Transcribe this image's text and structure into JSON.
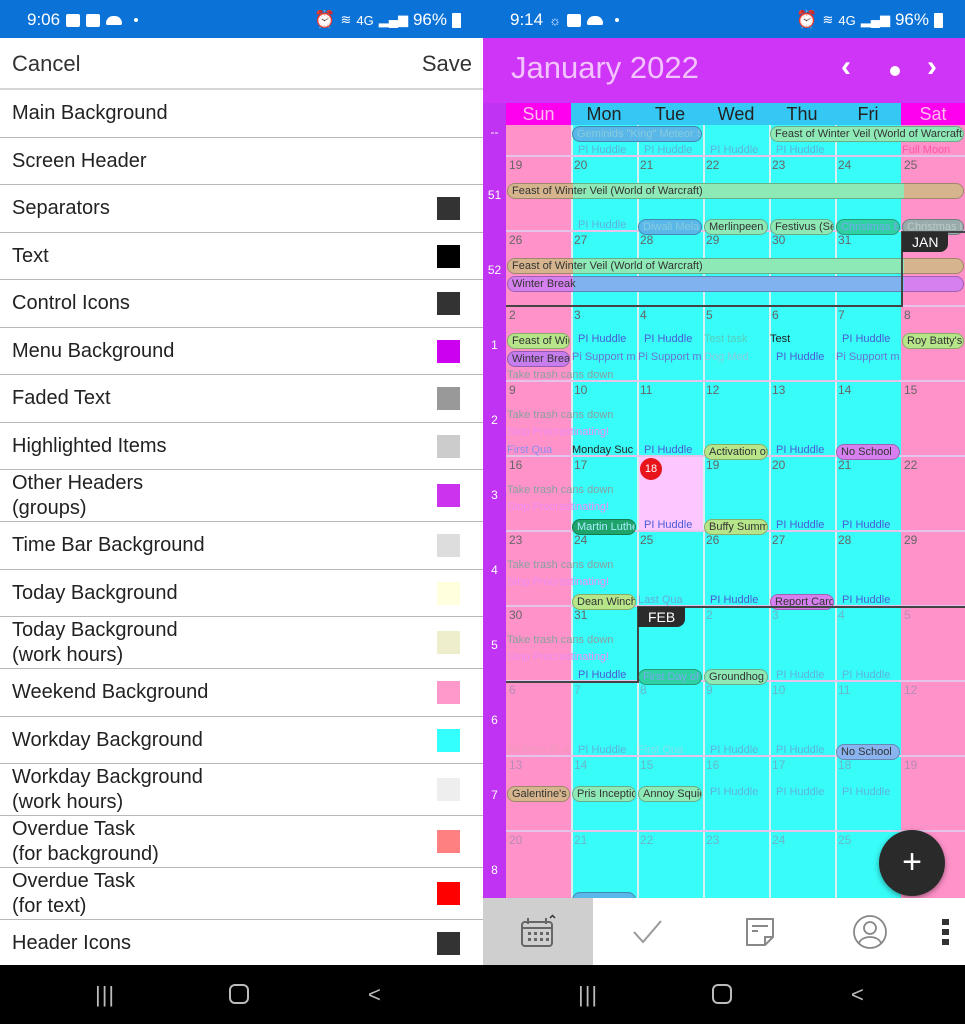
{
  "left": {
    "status_bar": {
      "time": "9:06",
      "battery": "96%",
      "network": "4G"
    },
    "header": {
      "cancel_label": "Cancel",
      "save_label": "Save"
    },
    "settings": [
      {
        "line1": "Main Background",
        "line2": "",
        "color": ""
      },
      {
        "line1": "Screen Header",
        "line2": "",
        "color": ""
      },
      {
        "line1": "Separators",
        "line2": "",
        "color": "#333333"
      },
      {
        "line1": "Text",
        "line2": "",
        "color": "#000000"
      },
      {
        "line1": "Control Icons",
        "line2": "",
        "color": "#333333"
      },
      {
        "line1": "Menu Background",
        "line2": "",
        "color": "#cc00ee"
      },
      {
        "line1": "Faded Text",
        "line2": "",
        "color": "#999999"
      },
      {
        "line1": "Highlighted Items",
        "line2": "",
        "color": "#cccccc"
      },
      {
        "line1": "Other Headers",
        "line2": "(groups)",
        "color": "#cc33ee"
      },
      {
        "line1": "Time Bar Background",
        "line2": "",
        "color": "#dddddd"
      },
      {
        "line1": "Today Background",
        "line2": "",
        "color": "#ffffdd"
      },
      {
        "line1": "Today Background",
        "line2": "(work hours)",
        "color": "#eeeecc"
      },
      {
        "line1": "Weekend Background",
        "line2": "",
        "color": "#ff99cc"
      },
      {
        "line1": "Workday Background",
        "line2": "",
        "color": "#33ffff"
      },
      {
        "line1": "Workday Background",
        "line2": "(work hours)",
        "color": "#eeeeee"
      },
      {
        "line1": "Overdue Task",
        "line2": "(for background)",
        "color": "#ff8080"
      },
      {
        "line1": "Overdue Task",
        "line2": "(for text)",
        "color": "#ff0000"
      },
      {
        "line1": "Header Icons",
        "line2": "",
        "color": "#333333"
      }
    ],
    "nav": {
      "recent": "recent-apps",
      "home": "home",
      "back": "back"
    }
  },
  "right": {
    "status_bar": {
      "time": "9:14",
      "battery": "96%",
      "network": "4G"
    },
    "header": {
      "title": "January 2022",
      "prev_icon": "‹",
      "next_icon": "›"
    },
    "day_headers": [
      "Sun",
      "Mon",
      "Tue",
      "Wed",
      "Thu",
      "Fri",
      "Sat"
    ],
    "weeks": [
      {
        "num": "--",
        "days": [
          "",
          "",
          "",
          "",
          "",
          "",
          ""
        ]
      },
      {
        "num": "51",
        "days": [
          "19",
          "20",
          "21",
          "22",
          "23",
          "24",
          "25"
        ]
      },
      {
        "num": "52",
        "days": [
          "26",
          "27",
          "28",
          "29",
          "30",
          "31",
          ""
        ]
      },
      {
        "num": "1",
        "days": [
          "2",
          "3",
          "4",
          "5",
          "6",
          "7",
          "8"
        ]
      },
      {
        "num": "2",
        "days": [
          "9",
          "10",
          "11",
          "12",
          "13",
          "14",
          "15"
        ]
      },
      {
        "num": "3",
        "days": [
          "16",
          "17",
          "18",
          "19",
          "20",
          "21",
          "22"
        ]
      },
      {
        "num": "4",
        "days": [
          "23",
          "24",
          "25",
          "26",
          "27",
          "28",
          "29"
        ]
      },
      {
        "num": "5",
        "days": [
          "30",
          "31",
          "",
          "2",
          "3",
          "4",
          "5"
        ]
      },
      {
        "num": "6",
        "days": [
          "6",
          "7",
          "8",
          "9",
          "10",
          "11",
          "12"
        ]
      },
      {
        "num": "7",
        "days": [
          "13",
          "14",
          "15",
          "16",
          "17",
          "18",
          "19"
        ]
      },
      {
        "num": "8",
        "days": [
          "20",
          "21",
          "22",
          "23",
          "24",
          "25",
          ""
        ]
      }
    ],
    "today": "18",
    "month_markers": {
      "jan": "JAN",
      "feb": "FEB"
    },
    "events": {
      "geminids": "Geminids \"King\" Meteor Sh",
      "feast_long": "Feast of Winter Veil (World of Warcraft)",
      "feast_short": "Feast of Win",
      "full_moon": "Full Moon",
      "pi_huddle": "PI Huddle",
      "pi_support": "Pi Support m",
      "hanukkah": "Diwali Mela",
      "merlinpeen": "Merlinpeen (",
      "festivus": "Festivus (Se",
      "christmas_eve": "Christmas E",
      "christmas_day": "Christmas D",
      "winter_break": "Winter Break",
      "test_task": "Test task",
      "test": "Test",
      "dog_med": "Dog Med",
      "roy_batty": "Roy Batty's In",
      "take_trash": "Take trash cans down",
      "stop_procr": "Stop Procrastinating!",
      "first_quarter": "First Qua",
      "monday_suc": "Monday Suc",
      "activation": "Activation of",
      "no_school": "No School",
      "martin_luther": "Martin Luthe",
      "buffy": "Buffy Summ",
      "dean": "Dean Winche",
      "last_quarter": "Last Qua",
      "report_cards": "Report Cards",
      "first_day": "First Day of",
      "groundhog": "Groundhog D",
      "all_pros": "All-Pros @ A",
      "galentines": "Galentine's D",
      "pris": "Pris Inceptio",
      "annoy": "Annoy Squid"
    },
    "fab_label": "+",
    "toolbar": [
      "calendar",
      "tasks",
      "notes",
      "contacts",
      "more"
    ],
    "colors": {
      "header": "#cf35f7",
      "weekend": "#ff92c9",
      "workday": "#38fcf8",
      "today": "#fcc7ff",
      "week_column": "#c033f2"
    }
  }
}
